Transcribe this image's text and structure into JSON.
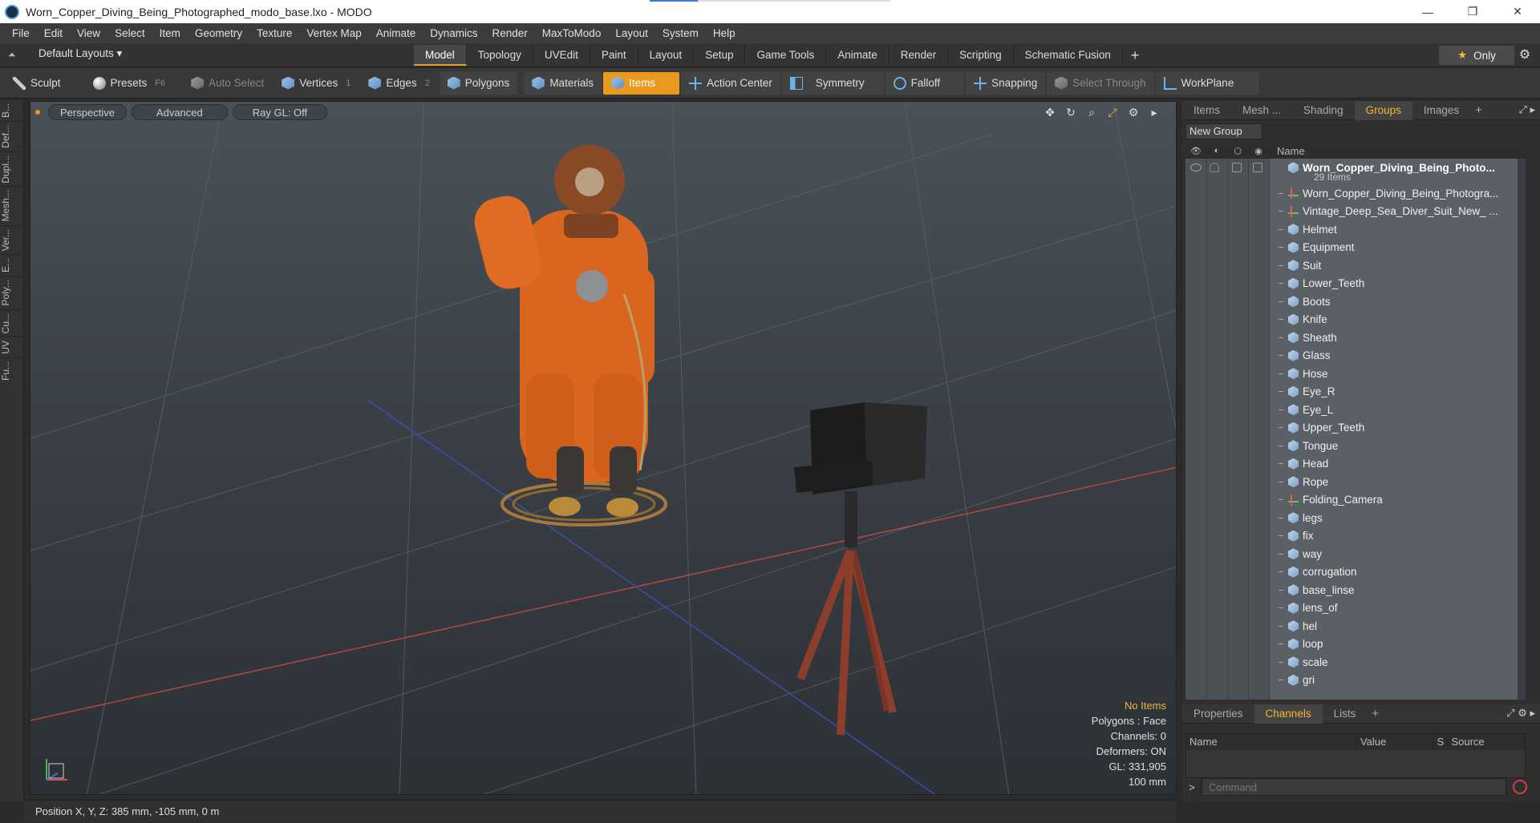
{
  "window": {
    "title": "Worn_Copper_Diving_Being_Photographed_modo_base.lxo - MODO",
    "minimize": "—",
    "maximize": "❐",
    "close": "✕"
  },
  "menu": [
    "File",
    "Edit",
    "View",
    "Select",
    "Item",
    "Geometry",
    "Texture",
    "Vertex Map",
    "Animate",
    "Dynamics",
    "Render",
    "MaxToModo",
    "Layout",
    "System",
    "Help"
  ],
  "layoutbar": {
    "layouts_label": "Default Layouts ▾",
    "tabs": [
      "Model",
      "Topology",
      "UVEdit",
      "Paint",
      "Layout",
      "Setup",
      "Game Tools",
      "Animate",
      "Render",
      "Scripting",
      "Schematic Fusion"
    ],
    "active_tab": "Model",
    "only_label": "Only"
  },
  "toolbar": {
    "sculpt": "Sculpt",
    "presets": "Presets",
    "presets_key": "F6",
    "auto_select": "Auto Select",
    "vertices": "Vertices",
    "vertices_key": "1",
    "edges": "Edges",
    "edges_key": "2",
    "polygons": "Polygons",
    "materials": "Materials",
    "items": "Items",
    "action_center": "Action Center",
    "symmetry": "Symmetry",
    "falloff": "Falloff",
    "snapping": "Snapping",
    "select_through": "Select Through",
    "workplane": "WorkPlane"
  },
  "left_tabs": [
    "B...",
    "Def...",
    "Dupl...",
    "Mesh...",
    "Ver...",
    "E...",
    "Poly...",
    "Cu...",
    "UV",
    "Fu..."
  ],
  "viewport": {
    "view": "Perspective",
    "shading": "Advanced",
    "raygl": "Ray GL: Off",
    "stats": {
      "selection": "No Items",
      "polygons": "Polygons : Face",
      "channels": "Channels: 0",
      "deformers": "Deformers: ON",
      "gl": "GL: 331,905",
      "unit": "100 mm"
    }
  },
  "status": {
    "position": "Position X, Y, Z:  385 mm, -105 mm, 0 m"
  },
  "right_panel": {
    "tabs": [
      "Items",
      "Mesh ...",
      "Shading",
      "Groups",
      "Images"
    ],
    "active_tab": "Groups",
    "new_group": "New Group",
    "column_name": "Name",
    "root": {
      "name": "Worn_Copper_Diving_Being_Photo...",
      "count": "29 Items"
    },
    "items": [
      {
        "name": "Worn_Copper_Diving_Being_Photogra...",
        "type": "locator"
      },
      {
        "name": "Vintage_Deep_Sea_Diver_Suit_New_ ...",
        "type": "locator"
      },
      {
        "name": "Helmet",
        "type": "mesh"
      },
      {
        "name": "Equipment",
        "type": "mesh"
      },
      {
        "name": "Suit",
        "type": "mesh"
      },
      {
        "name": "Lower_Teeth",
        "type": "mesh"
      },
      {
        "name": "Boots",
        "type": "mesh"
      },
      {
        "name": "Knife",
        "type": "mesh"
      },
      {
        "name": "Sheath",
        "type": "mesh"
      },
      {
        "name": "Glass",
        "type": "mesh"
      },
      {
        "name": "Hose",
        "type": "mesh"
      },
      {
        "name": "Eye_R",
        "type": "mesh"
      },
      {
        "name": "Eye_L",
        "type": "mesh"
      },
      {
        "name": "Upper_Teeth",
        "type": "mesh"
      },
      {
        "name": "Tongue",
        "type": "mesh"
      },
      {
        "name": "Head",
        "type": "mesh"
      },
      {
        "name": "Rope",
        "type": "mesh"
      },
      {
        "name": "Folding_Camera",
        "type": "locator"
      },
      {
        "name": "legs",
        "type": "mesh"
      },
      {
        "name": "fix",
        "type": "mesh"
      },
      {
        "name": "way",
        "type": "mesh"
      },
      {
        "name": "corrugation",
        "type": "mesh"
      },
      {
        "name": "base_linse",
        "type": "mesh"
      },
      {
        "name": "lens_of",
        "type": "mesh"
      },
      {
        "name": "hel",
        "type": "mesh"
      },
      {
        "name": "loop",
        "type": "mesh"
      },
      {
        "name": "scale",
        "type": "mesh"
      },
      {
        "name": "gri",
        "type": "mesh"
      }
    ],
    "bottom_tabs": [
      "Properties",
      "Channels",
      "Lists"
    ],
    "bottom_active": "Channels",
    "channel_columns": [
      "Name",
      "Value",
      "S",
      "Source"
    ],
    "command_placeholder": "Command"
  }
}
